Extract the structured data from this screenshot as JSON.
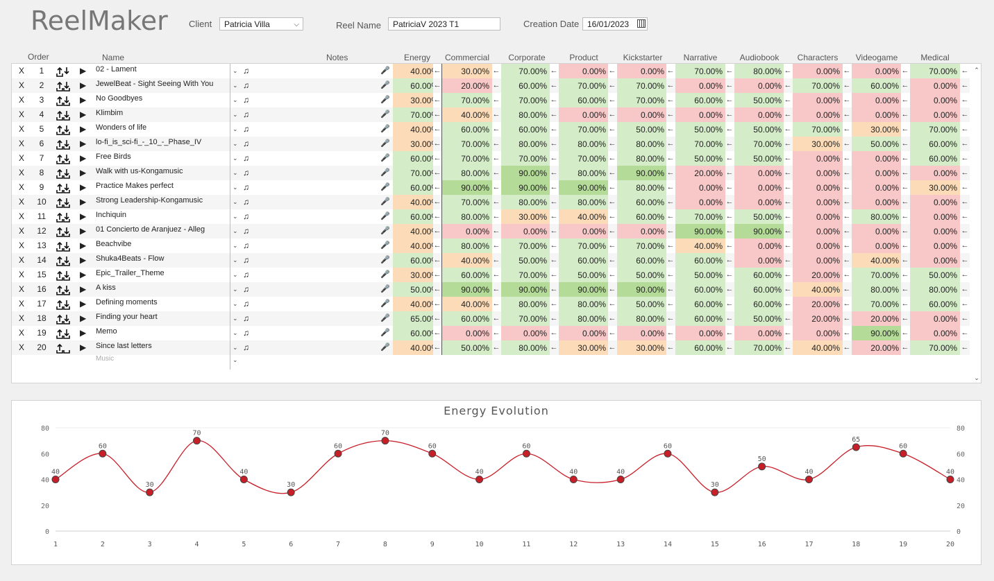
{
  "app_title": "ReelMaker",
  "header": {
    "client_label": "Client",
    "client_value": "Patricia Villa",
    "reel_label": "Reel Name",
    "reel_value": "PatriciaV 2023 T1",
    "date_label": "Creation Date",
    "date_value": "16/01/2023"
  },
  "columns": {
    "order": "Order",
    "name": "Name",
    "notes": "Notes",
    "categories": [
      "Energy",
      "Commercial",
      "Corporate",
      "Product",
      "Kickstarter",
      "Narrative",
      "Audiobook",
      "Characters",
      "Videogame",
      "Medical"
    ]
  },
  "rows": [
    {
      "n": "1",
      "name": "02 - Lament",
      "vals": [
        "40.00%",
        "30.00%",
        "70.00%",
        "0.00%",
        "0.00%",
        "70.00%",
        "80.00%",
        "0.00%",
        "0.00%",
        "70.00%"
      ]
    },
    {
      "n": "2",
      "name": "JewelBeat - Sight Seeing With You",
      "vals": [
        "60.00%",
        "20.00%",
        "60.00%",
        "70.00%",
        "70.00%",
        "0.00%",
        "0.00%",
        "70.00%",
        "60.00%",
        "0.00%"
      ]
    },
    {
      "n": "3",
      "name": "No Goodbyes",
      "vals": [
        "30.00%",
        "70.00%",
        "70.00%",
        "60.00%",
        "70.00%",
        "60.00%",
        "50.00%",
        "0.00%",
        "0.00%",
        "0.00%"
      ]
    },
    {
      "n": "4",
      "name": "Klimbim",
      "vals": [
        "70.00%",
        "40.00%",
        "80.00%",
        "0.00%",
        "0.00%",
        "0.00%",
        "0.00%",
        "0.00%",
        "0.00%",
        "0.00%"
      ]
    },
    {
      "n": "5",
      "name": "Wonders of life",
      "vals": [
        "40.00%",
        "60.00%",
        "60.00%",
        "70.00%",
        "50.00%",
        "50.00%",
        "50.00%",
        "70.00%",
        "30.00%",
        "70.00%"
      ]
    },
    {
      "n": "6",
      "name": "lo-fi_is_sci-fi_-_10_-_Phase_IV",
      "vals": [
        "30.00%",
        "70.00%",
        "80.00%",
        "80.00%",
        "80.00%",
        "70.00%",
        "70.00%",
        "30.00%",
        "50.00%",
        "60.00%"
      ]
    },
    {
      "n": "7",
      "name": "Free Birds",
      "vals": [
        "60.00%",
        "70.00%",
        "70.00%",
        "70.00%",
        "80.00%",
        "50.00%",
        "50.00%",
        "0.00%",
        "0.00%",
        "60.00%"
      ]
    },
    {
      "n": "8",
      "name": "Walk with us-Kongamusic",
      "vals": [
        "70.00%",
        "80.00%",
        "90.00%",
        "80.00%",
        "90.00%",
        "20.00%",
        "0.00%",
        "0.00%",
        "0.00%",
        "0.00%"
      ]
    },
    {
      "n": "9",
      "name": "Practice Makes perfect",
      "vals": [
        "60.00%",
        "90.00%",
        "90.00%",
        "90.00%",
        "80.00%",
        "0.00%",
        "0.00%",
        "0.00%",
        "0.00%",
        "30.00%"
      ]
    },
    {
      "n": "10",
      "name": "Strong Leadership-Kongamusic",
      "vals": [
        "40.00%",
        "70.00%",
        "80.00%",
        "80.00%",
        "60.00%",
        "0.00%",
        "0.00%",
        "0.00%",
        "0.00%",
        "0.00%"
      ]
    },
    {
      "n": "11",
      "name": "Inchiquin",
      "vals": [
        "60.00%",
        "80.00%",
        "30.00%",
        "40.00%",
        "60.00%",
        "70.00%",
        "50.00%",
        "0.00%",
        "80.00%",
        "0.00%"
      ]
    },
    {
      "n": "12",
      "name": "01 Concierto de Aranjuez - Alleg",
      "vals": [
        "40.00%",
        "0.00%",
        "0.00%",
        "0.00%",
        "0.00%",
        "90.00%",
        "90.00%",
        "0.00%",
        "0.00%",
        "0.00%"
      ]
    },
    {
      "n": "13",
      "name": "Beachvibe",
      "vals": [
        "40.00%",
        "80.00%",
        "70.00%",
        "70.00%",
        "70.00%",
        "40.00%",
        "0.00%",
        "0.00%",
        "0.00%",
        "0.00%"
      ]
    },
    {
      "n": "14",
      "name": "Shuka4Beats - Flow",
      "vals": [
        "60.00%",
        "40.00%",
        "50.00%",
        "60.00%",
        "60.00%",
        "60.00%",
        "0.00%",
        "0.00%",
        "40.00%",
        "0.00%"
      ]
    },
    {
      "n": "15",
      "name": "Epic_Trailer_Theme",
      "vals": [
        "30.00%",
        "60.00%",
        "70.00%",
        "50.00%",
        "50.00%",
        "50.00%",
        "60.00%",
        "20.00%",
        "70.00%",
        "50.00%"
      ]
    },
    {
      "n": "16",
      "name": "A kiss",
      "vals": [
        "50.00%",
        "90.00%",
        "90.00%",
        "90.00%",
        "90.00%",
        "60.00%",
        "60.00%",
        "40.00%",
        "80.00%",
        "80.00%"
      ]
    },
    {
      "n": "17",
      "name": "Defining moments",
      "vals": [
        "40.00%",
        "40.00%",
        "80.00%",
        "80.00%",
        "50.00%",
        "60.00%",
        "60.00%",
        "20.00%",
        "70.00%",
        "60.00%"
      ]
    },
    {
      "n": "18",
      "name": "Finding your heart",
      "vals": [
        "65.00%",
        "60.00%",
        "70.00%",
        "80.00%",
        "80.00%",
        "60.00%",
        "50.00%",
        "20.00%",
        "20.00%",
        "0.00%"
      ]
    },
    {
      "n": "19",
      "name": "Memo",
      "vals": [
        "60.00%",
        "0.00%",
        "0.00%",
        "0.00%",
        "0.00%",
        "0.00%",
        "0.00%",
        "0.00%",
        "90.00%",
        "0.00%"
      ]
    },
    {
      "n": "20",
      "name": "Since last letters",
      "vals": [
        "40.00%",
        "50.00%",
        "80.00%",
        "30.00%",
        "30.00%",
        "60.00%",
        "70.00%",
        "40.00%",
        "20.00%",
        "70.00%"
      ]
    }
  ],
  "new_row_placeholder": "Music",
  "row_delete_label": "X",
  "colors": {
    "red": "#f8c8c8",
    "orange": "#fcdcb8",
    "light_green": "#d4ecc8",
    "green": "#b4dc98",
    "line": "#c81e28"
  },
  "chart_data": {
    "type": "line",
    "title": "Energy Evolution",
    "x": [
      1,
      2,
      3,
      4,
      5,
      6,
      7,
      8,
      9,
      10,
      11,
      12,
      13,
      14,
      15,
      16,
      17,
      18,
      19,
      20
    ],
    "values": [
      40,
      60,
      30,
      70,
      40,
      30,
      60,
      70,
      60,
      40,
      60,
      40,
      40,
      60,
      30,
      50,
      40,
      65,
      60,
      40
    ],
    "ylim": [
      0,
      80
    ],
    "yticks": [
      0,
      20,
      40,
      60,
      80
    ],
    "grid": false,
    "legend": "none"
  }
}
